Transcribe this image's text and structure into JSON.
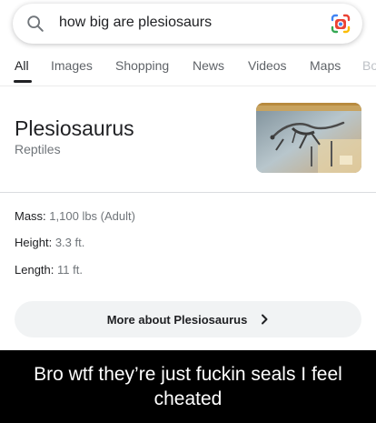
{
  "search": {
    "query": "how big are plesiosaurs",
    "search_icon": "magnifier-icon",
    "lens_icon": "google-lens-icon"
  },
  "tabs": [
    {
      "label": "All",
      "active": true
    },
    {
      "label": "Images",
      "active": false
    },
    {
      "label": "Shopping",
      "active": false
    },
    {
      "label": "News",
      "active": false
    },
    {
      "label": "Videos",
      "active": false
    },
    {
      "label": "Maps",
      "active": false
    },
    {
      "label": "Bo",
      "active": false
    }
  ],
  "entity": {
    "title": "Plesiosaurus",
    "subtitle": "Reptiles",
    "image": "plesiosaurus-skeleton-photo"
  },
  "facts": [
    {
      "label": "Mass:",
      "value": "1,100 lbs (Adult)"
    },
    {
      "label": "Height:",
      "value": "3.3 ft."
    },
    {
      "label": "Length:",
      "value": "11 ft."
    }
  ],
  "more_button": {
    "label": "More about Plesiosaurus",
    "icon": "chevron-right-icon"
  },
  "caption": "Bro wtf they’re just fuckin seals I feel cheated",
  "colors": {
    "text_primary": "#202124",
    "text_secondary": "#70757a",
    "chip_background": "#f1f3f4",
    "caption_background": "#000000",
    "caption_text": "#ffffff"
  }
}
